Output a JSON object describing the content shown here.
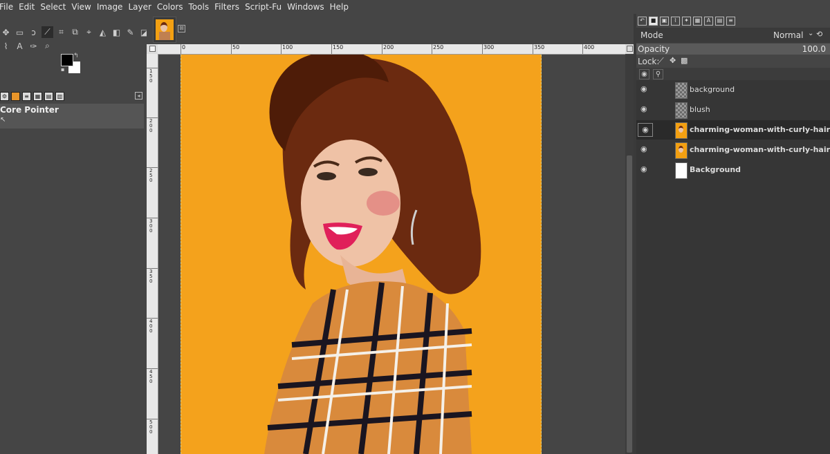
{
  "menu": [
    "File",
    "Edit",
    "Select",
    "View",
    "Image",
    "Layer",
    "Colors",
    "Tools",
    "Filters",
    "Script-Fu",
    "Windows",
    "Help"
  ],
  "toolbox": {
    "row1_icons": [
      "move-tool-icon",
      "rect-select-icon",
      "lasso-icon",
      "fuzzy-select-icon",
      "crop-icon",
      "unified-transform-icon",
      "warp-icon",
      "bucket-fill-icon",
      "gradient-icon",
      "paintbrush-icon",
      "eraser-icon",
      "smudge-icon"
    ],
    "row2_icons": [
      "paths-icon",
      "text-icon",
      "color-picker-icon",
      "zoom-icon"
    ],
    "row1_glyphs": [
      "✥",
      "▭",
      "ↄ",
      "⟋",
      "⌗",
      "⧉",
      "⌖",
      "◭",
      "◧",
      "✎",
      "◪",
      "☁"
    ],
    "row2_glyphs": [
      "⌇",
      "A",
      "✑",
      "⌕"
    ],
    "foreground_color": "#000000",
    "background_color": "#ffffff",
    "panel_title": "Core Pointer"
  },
  "image_tab": {
    "close_glyph": "⊠"
  },
  "ruler": {
    "h_labels": [
      "0",
      "50",
      "100",
      "150",
      "200",
      "250",
      "300",
      "350",
      "400"
    ],
    "v_labels": [
      "150",
      "200",
      "250",
      "300",
      "350",
      "400",
      "450",
      "500"
    ]
  },
  "dock": {
    "mode_label": "Mode",
    "mode_value": "Normal",
    "opacity_label": "Opacity",
    "opacity_value": "100.0",
    "lock_label": "Lock:",
    "layers": [
      {
        "name": "background",
        "thumb": "checker",
        "bold": false,
        "selected": false
      },
      {
        "name": "blush",
        "thumb": "checker",
        "bold": false,
        "selected": false
      },
      {
        "name": "charming-woman-with-curly-hairstyle-lo",
        "thumb": "photo",
        "bold": true,
        "selected": true
      },
      {
        "name": "charming-woman-with-curly-hairstyle-lo",
        "thumb": "photo",
        "bold": true,
        "selected": false
      },
      {
        "name": "Background",
        "thumb": "white",
        "bold": true,
        "selected": false
      }
    ]
  },
  "colors": {
    "canvas_orange": "#f4a21c",
    "hair": "#6b2a10",
    "skin": "#efc2a6",
    "lips": "#e0205a"
  }
}
